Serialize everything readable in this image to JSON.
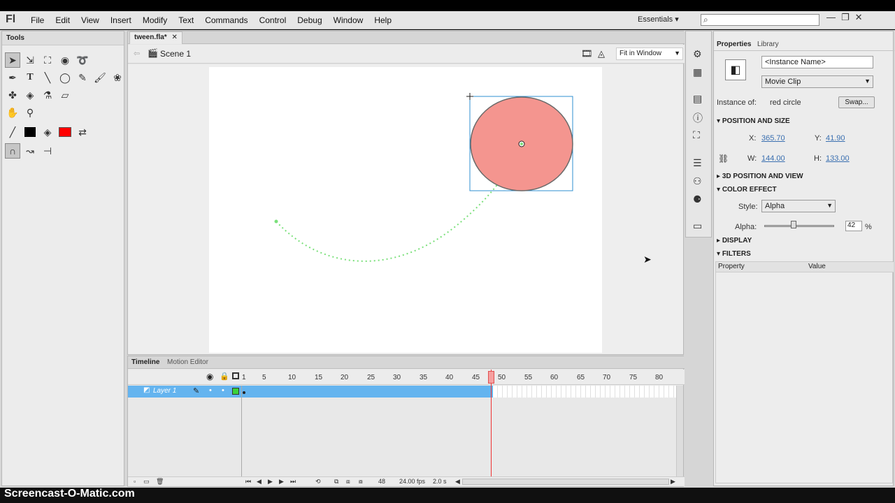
{
  "app": {
    "logo": "Fl"
  },
  "menu": [
    "File",
    "Edit",
    "View",
    "Insert",
    "Modify",
    "Text",
    "Commands",
    "Control",
    "Debug",
    "Window",
    "Help"
  ],
  "workspace": "Essentials",
  "window_buttons": [
    "—",
    "❐",
    "✕"
  ],
  "tools_panel": {
    "title": "Tools"
  },
  "document": {
    "tab": "tween.fla*",
    "scene": "Scene 1",
    "zoom": "Fit in Window"
  },
  "timeline": {
    "tabs": [
      "Timeline",
      "Motion Editor"
    ],
    "layer": "Layer 1",
    "frame_numbers": [
      "1",
      "5",
      "10",
      "15",
      "20",
      "25",
      "30",
      "35",
      "40",
      "45",
      "50",
      "55",
      "60",
      "65",
      "70",
      "75",
      "80"
    ],
    "current_frame": "48",
    "fps": "24.00 fps",
    "time": "2.0 s"
  },
  "properties": {
    "tabs": [
      "Properties",
      "Library"
    ],
    "instance_name_placeholder": "<Instance Name>",
    "symbol_type": "Movie Clip",
    "instance_of_label": "Instance of:",
    "instance_of_value": "red circle",
    "swap_button": "Swap...",
    "position_and_size": "POSITION AND SIZE",
    "x_label": "X:",
    "x": "365.70",
    "y_label": "Y:",
    "y": "41.90",
    "w_label": "W:",
    "w": "144.00",
    "h_label": "H:",
    "h": "133.00",
    "section_3d": "3D POSITION AND VIEW",
    "color_effect": "COLOR EFFECT",
    "style_label": "Style:",
    "style_value": "Alpha",
    "alpha_label": "Alpha:",
    "alpha_value": "42",
    "alpha_unit": "%",
    "alpha_level": 0.42,
    "display": "DISPLAY",
    "filters": "FILTERS",
    "filter_cols": [
      "Property",
      "Value"
    ]
  },
  "colors": {
    "circle_fill": "#f4958f",
    "motion_path": "#7be07b",
    "layer_highlight": "#64b4ef",
    "playhead": "#e33333"
  },
  "watermark": "Screencast-O-Matic.com"
}
